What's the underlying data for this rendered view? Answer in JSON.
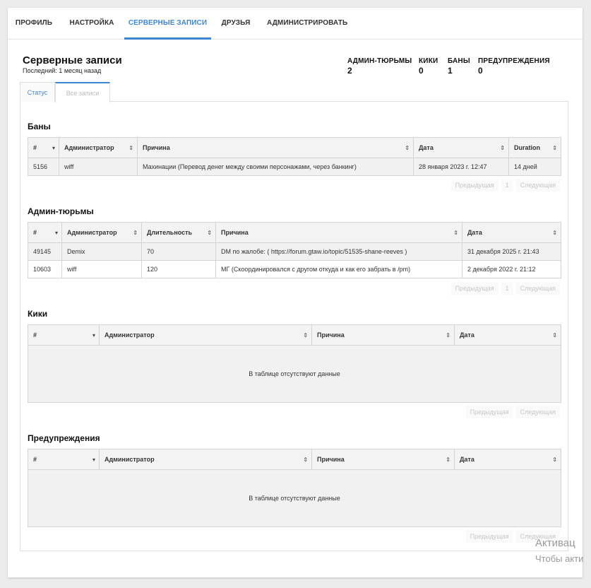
{
  "nav": {
    "items": [
      "ПРОФИЛЬ",
      "НАСТРОЙКА",
      "СЕРВЕРНЫЕ ЗАПИСИ",
      "ДРУЗЬЯ",
      "АДМИНИСТРИРОВАТЬ"
    ],
    "active": "СЕРВЕРНЫЕ ЗАПИСИ"
  },
  "header": {
    "title": "Серверные записи",
    "subtitle": "Последний: 1 месяц назад"
  },
  "stats": [
    {
      "label": "АДМИН-ТЮРЬМЫ",
      "value": "2"
    },
    {
      "label": "КИКИ",
      "value": "0"
    },
    {
      "label": "БАНЫ",
      "value": "1"
    },
    {
      "label": "ПРЕДУПРЕЖДЕНИЯ",
      "value": "0"
    }
  ],
  "tabs": {
    "status": "Статус",
    "all": "Все записи"
  },
  "bans": {
    "title": "Баны",
    "columns": [
      "#",
      "Администратор",
      "Причина",
      "Дата",
      "Duration"
    ],
    "rows": [
      [
        "5156",
        "wiff",
        "Махинации (Перевод денег между своими персонажами, через банкинг)",
        "28 января 2023 г. 12:47",
        "14 дней"
      ]
    ]
  },
  "jails": {
    "title": "Админ-тюрьмы",
    "columns": [
      "#",
      "Администратор",
      "Длительность",
      "Причина",
      "Дата"
    ],
    "rows": [
      [
        "49145",
        "Demix",
        "70",
        "DM по жалобе: ( https://forum.gtaw.io/topic/51535-shane-reeves )",
        "31 декабря 2025 г. 21:43"
      ],
      [
        "10603",
        "wiff",
        "120",
        "МГ (Скоординировался с другом откуда и как его забрать в /pm)",
        "2 декабря 2022 г. 21:12"
      ]
    ]
  },
  "kicks": {
    "title": "Кики",
    "columns": [
      "#",
      "Администратор",
      "Причина",
      "Дата"
    ],
    "empty": "В таблице отсутствуют данные"
  },
  "warnings": {
    "title": "Предупреждения",
    "columns": [
      "#",
      "Администратор",
      "Причина",
      "Дата"
    ],
    "empty": "В таблице отсутствуют данные"
  },
  "pager": {
    "prev": "Предыдущая",
    "page": "1",
    "next": "Следующая"
  },
  "watermark": {
    "line1": "Активац",
    "line2": "Чтобы акти"
  },
  "colors": {
    "accent": "#3d86d6"
  }
}
